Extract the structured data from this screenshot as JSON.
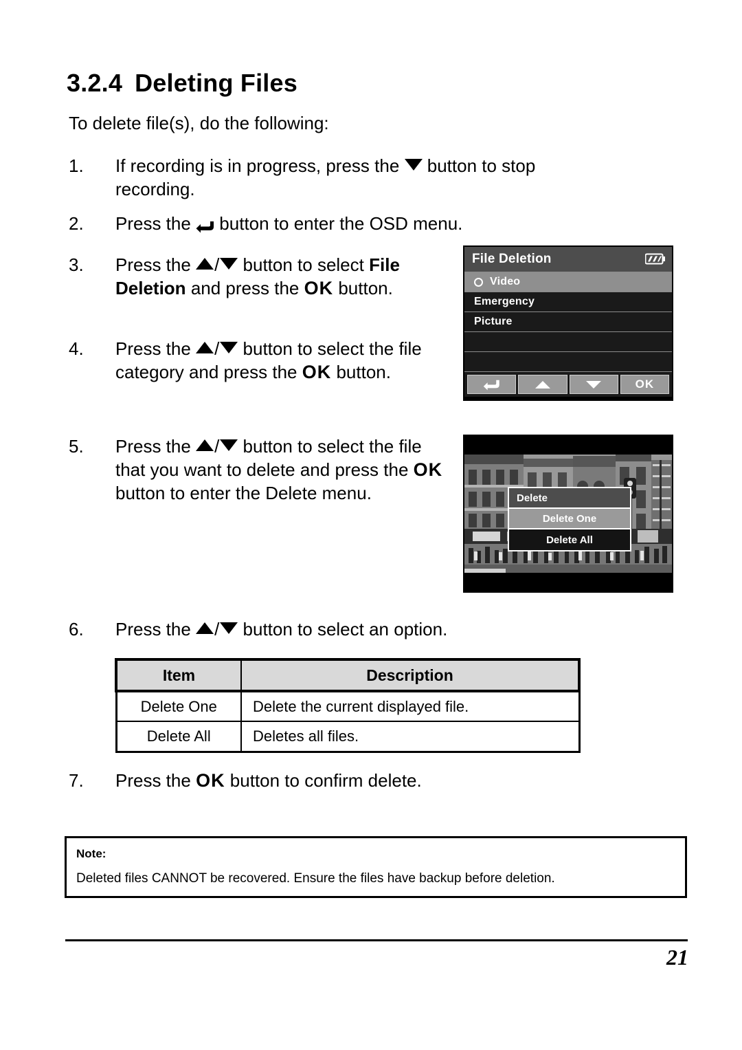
{
  "document": {
    "heading_number": "3.2.4",
    "heading_title": "Deleting Files",
    "intro": "To delete file(s), do the following:",
    "steps": [
      {
        "marker": "1.",
        "text_before": "If recording is in progress, press the",
        "icon": "triangle-down-icon",
        "text_after": "button to stop recording."
      },
      {
        "marker": "2.",
        "text_before": "Press the",
        "icon": "return-arrow-icon",
        "text_after": "button to enter the OSD menu."
      },
      {
        "marker": "3.",
        "text_before": "Press the",
        "icon": "triangle-up-down-icon",
        "text_mid": "button to select",
        "bold_term": "File Deletion",
        "text_after": "and press the",
        "icon2": "ok-icon",
        "text_end": "button."
      },
      {
        "marker": "4.",
        "text_before": "Press the",
        "icon": "triangle-up-down-icon",
        "text_mid": "button to select the file category and press the",
        "icon2": "ok-icon",
        "text_end": "button."
      },
      {
        "marker": "5.",
        "text_before": "Press the",
        "icon": "triangle-up-down-icon",
        "text_mid": "button to select the file that you want to delete and press the",
        "icon2": "ok-icon",
        "text_end": "button to enter the Delete menu."
      },
      {
        "marker": "6.",
        "text_before": "Press the",
        "icon": "triangle-up-down-icon",
        "text_after": "button to select an option."
      },
      {
        "marker": "7.",
        "text_before": "Press the",
        "icon": "ok-icon",
        "text_after": "button to confirm delete."
      }
    ],
    "page_number": "21"
  },
  "osd_menu": {
    "title": "File Deletion",
    "battery_icon": "battery-full-icon",
    "rows": [
      {
        "label": "Video",
        "selected": true,
        "radio": true
      },
      {
        "label": "Emergency",
        "selected": false,
        "radio": false
      },
      {
        "label": "Picture",
        "selected": false,
        "radio": false
      },
      {
        "label": "",
        "selected": false,
        "radio": false
      },
      {
        "label": "",
        "selected": false,
        "radio": false
      }
    ],
    "nav_buttons": [
      {
        "label": "",
        "icon": "return-arrow-icon"
      },
      {
        "label": "",
        "icon": "triangle-up-icon"
      },
      {
        "label": "",
        "icon": "triangle-down-icon"
      },
      {
        "label": "OK",
        "icon": "ok-icon"
      }
    ],
    "colors": {
      "title_bg": "#4d4d4d",
      "row_bg": "#1a1a1a",
      "row_selected_bg": "#8f8f8f",
      "nav_btn_bg": "#9a9a9a",
      "text": "#ffffff"
    }
  },
  "delete_screen": {
    "menu": {
      "header": "Delete",
      "options": [
        {
          "label": "Delete One",
          "selected": true
        },
        {
          "label": "Delete All",
          "selected": false
        }
      ]
    },
    "colors": {
      "header_bg": "#4d4d4d",
      "selected_bg": "#9a9a9a",
      "option_bg": "#141414",
      "border": "#ffffff"
    }
  },
  "table": {
    "headers": [
      "Item",
      "Description"
    ],
    "rows": [
      [
        "Delete One",
        "Delete the current displayed file."
      ],
      [
        "Delete All",
        "Deletes all files."
      ]
    ],
    "header_bg": "#d9d9d9"
  },
  "note": {
    "title": "Note:",
    "text": "Deleted files CANNOT be recovered. Ensure the files have backup before deletion."
  }
}
